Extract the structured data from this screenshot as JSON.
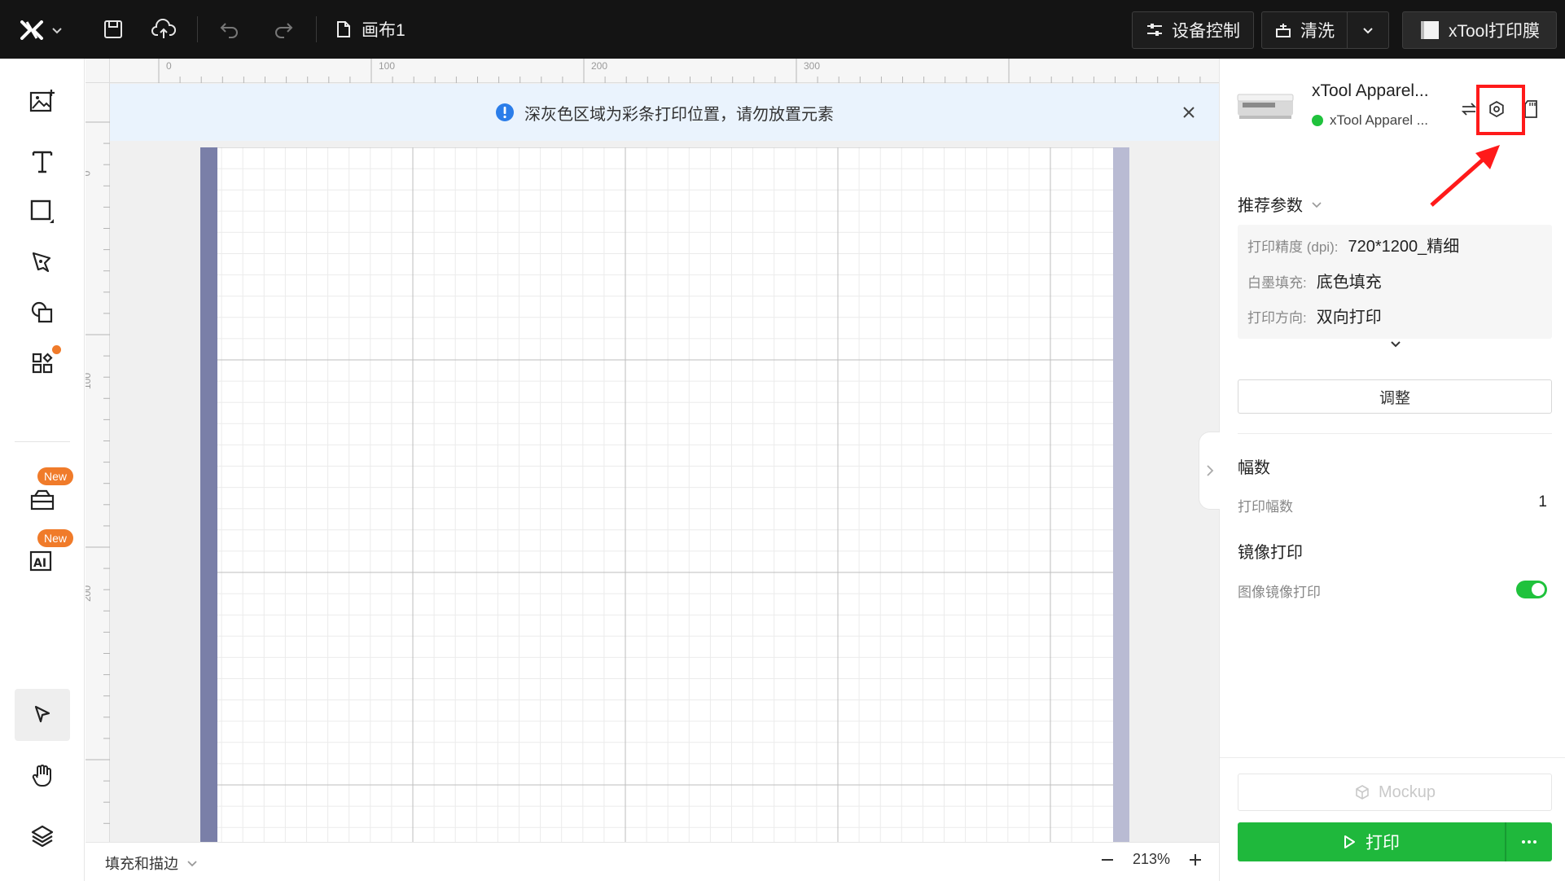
{
  "topbar": {
    "logo_icon": "xtool-logo-icon",
    "file_name": "画布1",
    "device_control_label": "设备控制",
    "clean_label": "清洗",
    "printer_label": "xTool打印膜"
  },
  "notice": {
    "text": "深灰色区域为彩条打印位置，请勿放置元素"
  },
  "ruler": {
    "top_marks": [
      "0",
      "100",
      "200",
      "300"
    ],
    "left_marks": [
      "0",
      "100",
      "200"
    ]
  },
  "left_tools": {
    "badges": [
      "New",
      "New"
    ]
  },
  "bottombar": {
    "fill_label": "填充和描边",
    "zoom": "213%"
  },
  "device": {
    "name": "xTool Apparel...",
    "status": "xTool Apparel ..."
  },
  "params": {
    "title": "推荐参数",
    "precision_key": "打印精度 (dpi):",
    "precision_val": "720*1200_精细",
    "white_key": "白墨填充:",
    "white_val": "底色填充",
    "direction_key": "打印方向:",
    "direction_val": "双向打印",
    "adjust_label": "调整"
  },
  "copies": {
    "title": "幅数",
    "label": "打印幅数",
    "value": "1"
  },
  "mirror": {
    "title": "镜像打印",
    "label": "图像镜像打印",
    "enabled": true
  },
  "actions": {
    "mockup_label": "Mockup",
    "print_label": "打印"
  },
  "colors": {
    "accent_green": "#1fb83c",
    "highlight_red": "#ff1a1a",
    "badge_orange": "#f07b2a",
    "color_bar_left": "#7a7fa8",
    "color_bar_right": "#b9bbd3"
  }
}
